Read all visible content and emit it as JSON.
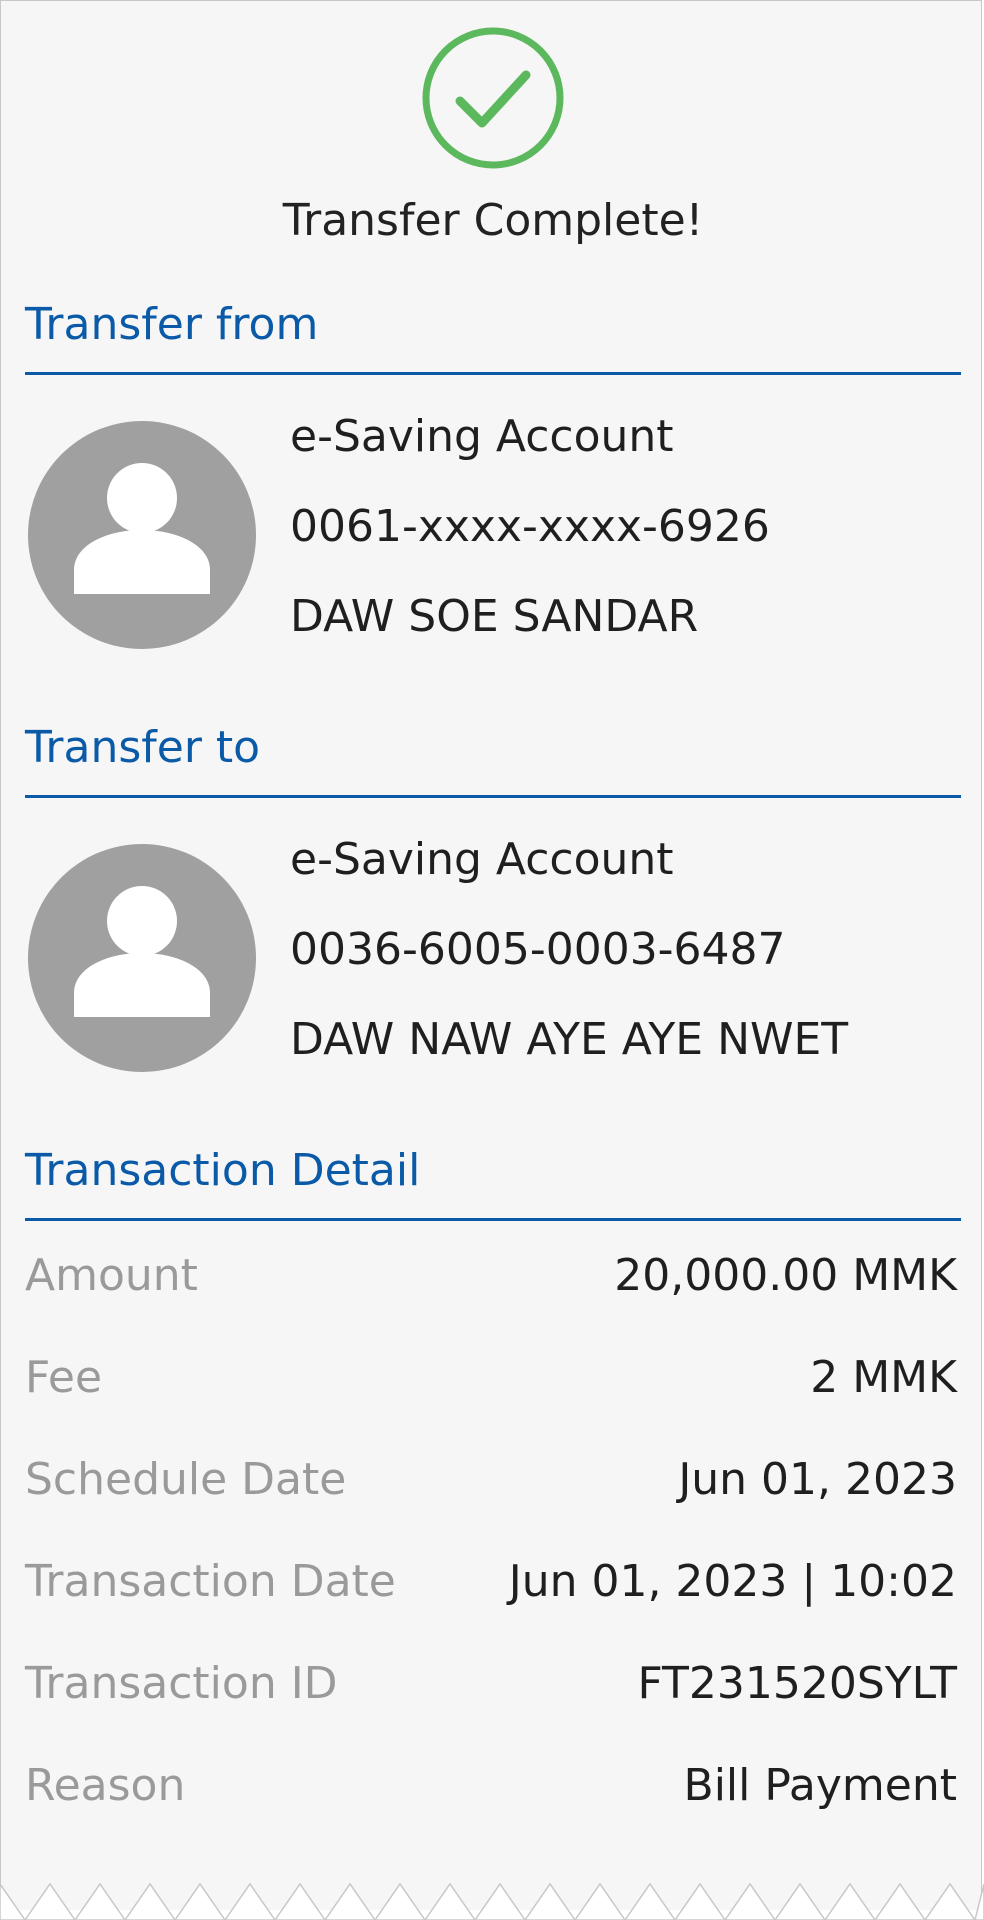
{
  "header": {
    "status_icon": "check-circle-icon",
    "title": "Transfer Complete!"
  },
  "colors": {
    "success": "#5cb85c",
    "accent": "#0a5aa8",
    "avatar": "#a0a0a0"
  },
  "transfer_from": {
    "heading": "Transfer from",
    "avatar_icon": "person-icon",
    "account_type": "e-Saving Account",
    "account_number": "0061-xxxx-xxxx-6926",
    "account_name": "DAW SOE SANDAR"
  },
  "transfer_to": {
    "heading": "Transfer to",
    "avatar_icon": "person-icon",
    "account_type": "e-Saving Account",
    "account_number": "0036-6005-0003-6487",
    "account_name": "DAW NAW AYE AYE NWET"
  },
  "transaction_detail": {
    "heading": "Transaction Detail",
    "rows": [
      {
        "label": "Amount",
        "value": "20,000.00 MMK"
      },
      {
        "label": "Fee",
        "value": "2 MMK"
      },
      {
        "label": "Schedule Date",
        "value": "Jun 01, 2023"
      },
      {
        "label": "Transaction Date",
        "value": "Jun 01, 2023 | 10:02"
      },
      {
        "label": "Transaction ID",
        "value": "FT231520SYLT"
      },
      {
        "label": "Reason",
        "value": "Bill Payment"
      }
    ]
  }
}
